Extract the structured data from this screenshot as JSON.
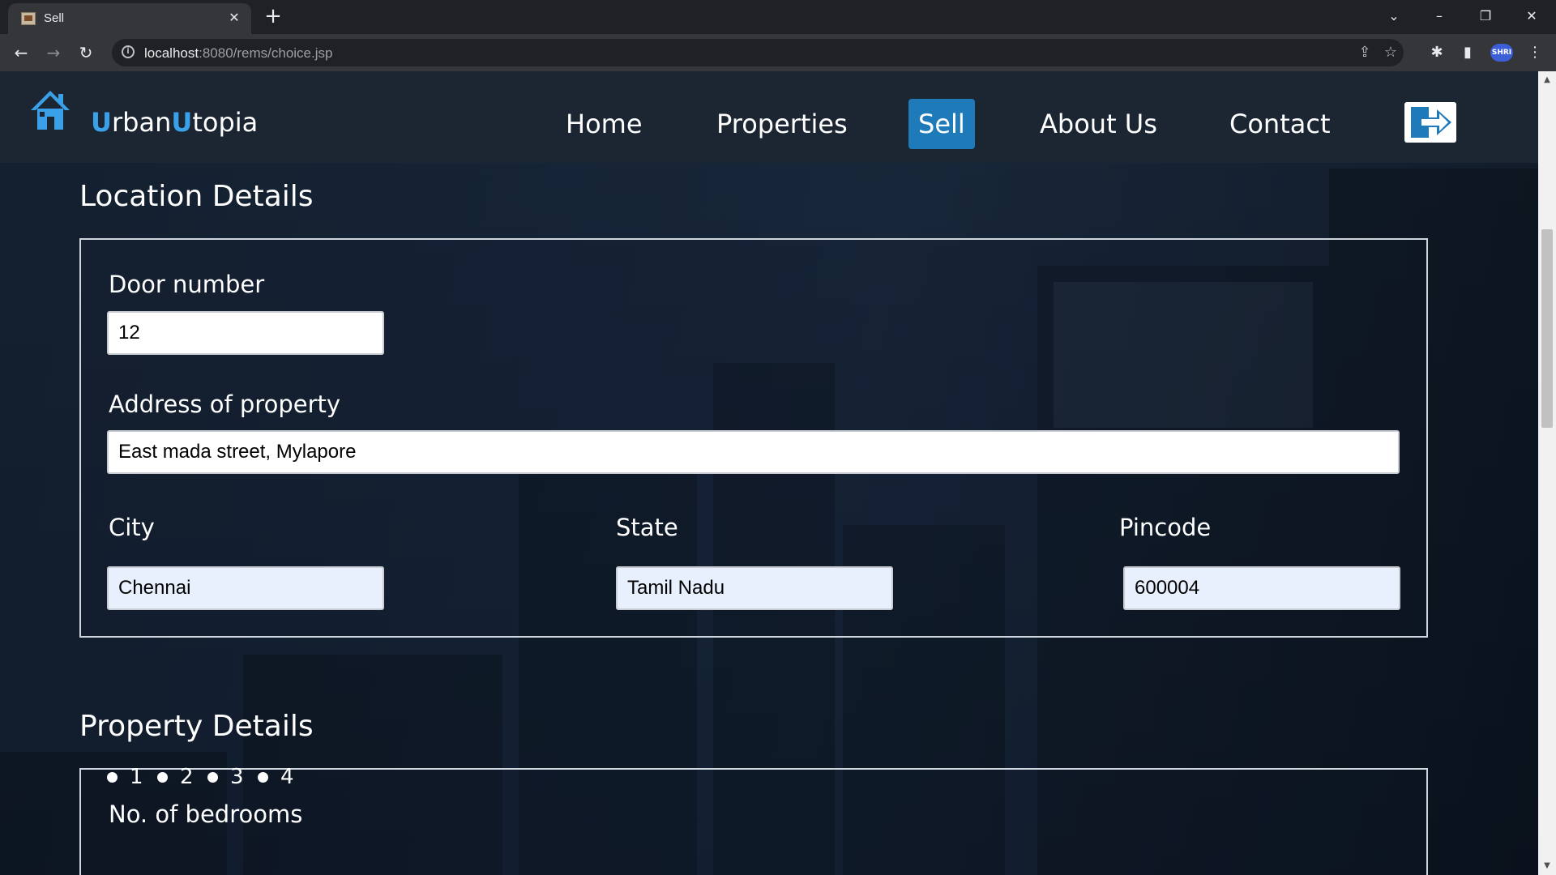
{
  "browser": {
    "tab_title": "Sell",
    "url_host": "localhost",
    "url_path": ":8080/rems/choice.jsp",
    "profile_label": "SHRI"
  },
  "site": {
    "brand_first_initial": "U",
    "brand_first_rest": "rban",
    "brand_second_initial": "U",
    "brand_second_rest": "topia",
    "nav": [
      {
        "label": "Home"
      },
      {
        "label": "Properties"
      },
      {
        "label": "Sell",
        "active": true
      },
      {
        "label": "About Us"
      },
      {
        "label": "Contact"
      }
    ],
    "accent_color": "#3aa0e8",
    "active_nav_color": "#1e7ab8"
  },
  "location": {
    "title": "Location Details",
    "door_label": "Door number",
    "door_value": "12",
    "address_label": "Address of property",
    "address_value": "East mada street, Mylapore",
    "city_label": "City",
    "city_value": "Chennai",
    "state_label": "State",
    "state_value": "Tamil Nadu",
    "pincode_label": "Pincode",
    "pincode_value": "600004"
  },
  "property": {
    "title": "Property Details",
    "bedrooms_label": "No. of bedrooms",
    "bedroom_options": [
      "1",
      "2",
      "3",
      "4"
    ]
  }
}
